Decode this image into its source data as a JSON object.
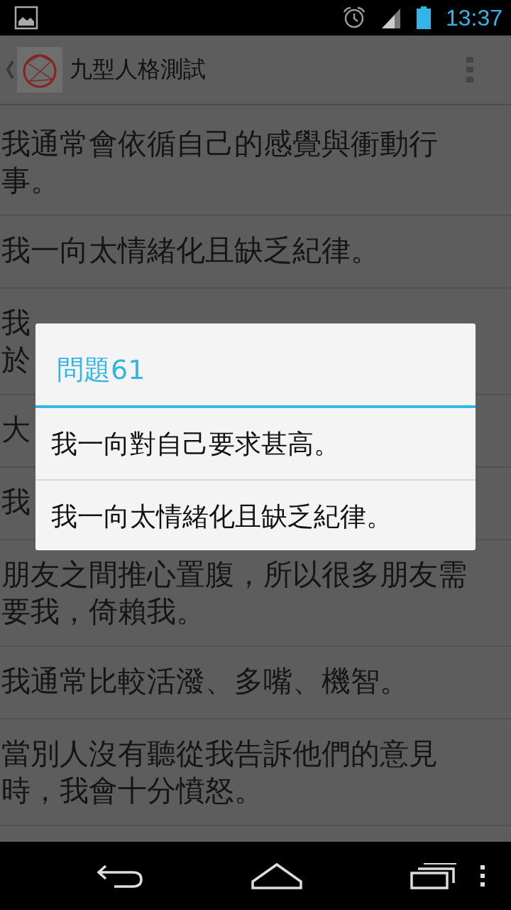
{
  "status_bar": {
    "time": "13:37"
  },
  "action_bar": {
    "title": "九型人格測試"
  },
  "questions": [
    {
      "lines": [
        "我通常會依循自己的感覺與衝動行",
        "事。"
      ]
    },
    {
      "lines": [
        "我一向太情緒化且缺乏紀律。"
      ]
    },
    {
      "lines": [
        "我",
        "於"
      ]
    },
    {
      "lines": [
        "大"
      ]
    },
    {
      "lines": [
        "我"
      ]
    },
    {
      "lines": [
        "朋友之間推心置腹，所以很多朋友需",
        "要我，倚賴我。"
      ]
    },
    {
      "lines": [
        "我通常比較活潑、多嘴、機智。"
      ]
    },
    {
      "lines": [
        "當別人沒有聽從我告訴他們的意見",
        "時，我會十分憤怒。"
      ]
    }
  ],
  "dialog": {
    "title": "問題61",
    "options": [
      "我一向對自己要求甚高。",
      "我一向太情緒化且缺乏紀律。"
    ]
  }
}
